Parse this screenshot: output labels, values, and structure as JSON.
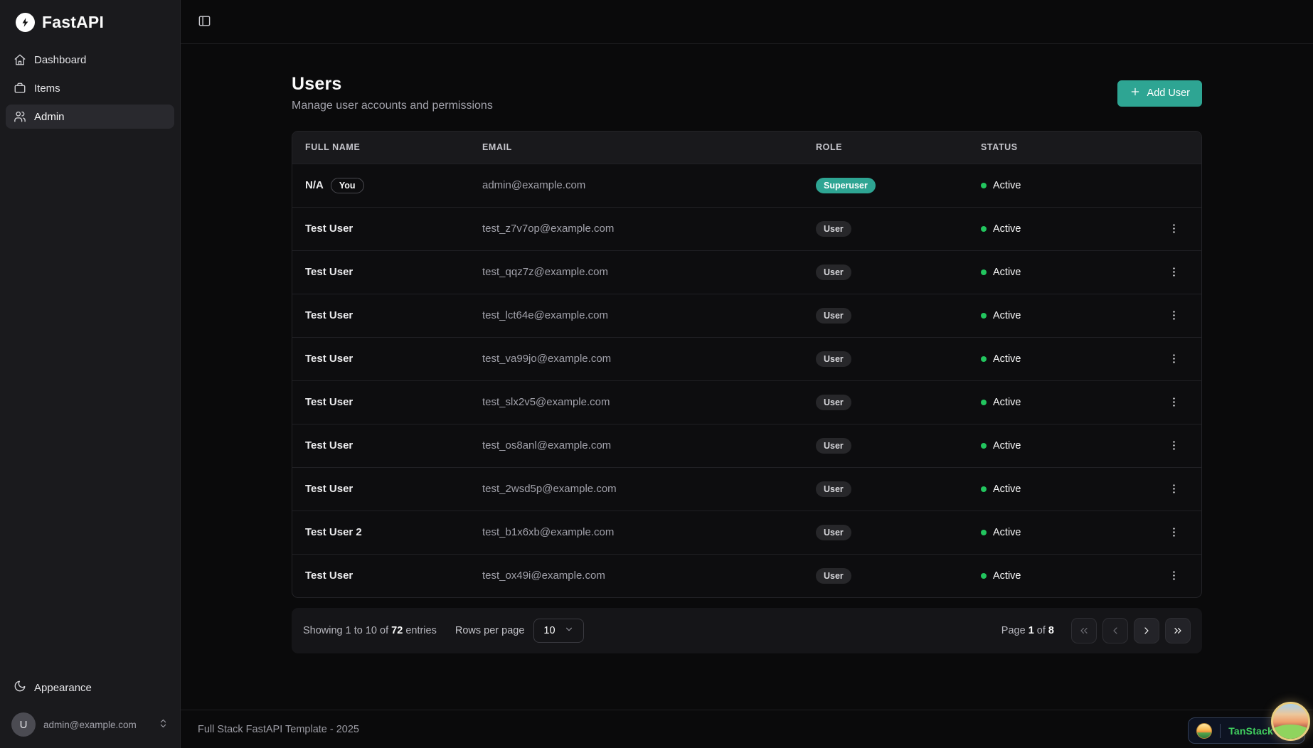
{
  "colors": {
    "accent": "#2ea593",
    "status_active": "#22c55e",
    "tanstack_green": "#41d05f"
  },
  "sidebar": {
    "brand": "FastAPI",
    "brand_icon": "lightning-bolt-icon",
    "nav": [
      {
        "label": "Dashboard",
        "icon": "home-icon",
        "active": false
      },
      {
        "label": "Items",
        "icon": "briefcase-icon",
        "active": false
      },
      {
        "label": "Admin",
        "icon": "users-icon",
        "active": true
      }
    ],
    "appearance": {
      "label": "Appearance",
      "icon": "moon-icon"
    },
    "user": {
      "avatar_initial": "U",
      "email": "admin@example.com",
      "icon": "chevrons-up-down-icon"
    }
  },
  "topbar": {
    "toggle_icon": "panel-left-icon"
  },
  "page": {
    "title": "Users",
    "subtitle": "Manage user accounts and permissions",
    "add_user_label": "Add User",
    "add_user_icon": "plus-icon"
  },
  "table": {
    "columns": [
      "Full Name",
      "Email",
      "Role",
      "Status"
    ],
    "rows": [
      {
        "name": "N/A",
        "you_badge": "You",
        "email": "admin@example.com",
        "role": "Superuser",
        "role_variant": "superuser",
        "status": "Active",
        "actions": false
      },
      {
        "name": "Test User",
        "email": "test_z7v7op@example.com",
        "role": "User",
        "role_variant": "user",
        "status": "Active",
        "actions": true
      },
      {
        "name": "Test User",
        "email": "test_qqz7z@example.com",
        "role": "User",
        "role_variant": "user",
        "status": "Active",
        "actions": true
      },
      {
        "name": "Test User",
        "email": "test_lct64e@example.com",
        "role": "User",
        "role_variant": "user",
        "status": "Active",
        "actions": true
      },
      {
        "name": "Test User",
        "email": "test_va99jo@example.com",
        "role": "User",
        "role_variant": "user",
        "status": "Active",
        "actions": true
      },
      {
        "name": "Test User",
        "email": "test_slx2v5@example.com",
        "role": "User",
        "role_variant": "user",
        "status": "Active",
        "actions": true
      },
      {
        "name": "Test User",
        "email": "test_os8anl@example.com",
        "role": "User",
        "role_variant": "user",
        "status": "Active",
        "actions": true
      },
      {
        "name": "Test User",
        "email": "test_2wsd5p@example.com",
        "role": "User",
        "role_variant": "user",
        "status": "Active",
        "actions": true
      },
      {
        "name": "Test User 2",
        "email": "test_b1x6xb@example.com",
        "role": "User",
        "role_variant": "user",
        "status": "Active",
        "actions": true
      },
      {
        "name": "Test User",
        "email": "test_ox49i@example.com",
        "role": "User",
        "role_variant": "user",
        "status": "Active",
        "actions": true
      }
    ],
    "row_actions_icon": "kebab-menu-icon"
  },
  "pagination": {
    "showing_before_total": "Showing 1 to 10 of ",
    "total_entries": "72",
    "showing_after_total": " entries",
    "rows_per_page_label": "Rows per page",
    "rows_per_page_value": "10",
    "rows_select_icon": "chevron-down-icon",
    "page_label": "Page",
    "current_page": "1",
    "of_label": "of",
    "total_pages": "8",
    "buttons": [
      {
        "name": "first-page-button",
        "icon": "chevrons-left-icon",
        "disabled": true
      },
      {
        "name": "previous-page-button",
        "icon": "chevron-left-icon",
        "disabled": true
      },
      {
        "name": "next-page-button",
        "icon": "chevron-right-icon",
        "disabled": false
      },
      {
        "name": "last-page-button",
        "icon": "chevrons-right-icon",
        "disabled": false
      }
    ]
  },
  "footer": {
    "text": "Full Stack FastAPI Template - 2025"
  },
  "devtools": {
    "label": "TanStack",
    "pill_icon": "island-icon",
    "button_icon": "sunset-island-icon"
  }
}
